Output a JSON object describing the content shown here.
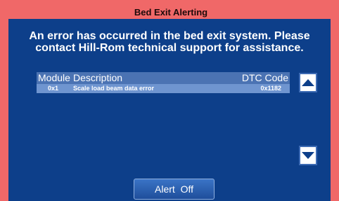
{
  "window": {
    "title": "Bed Exit Alerting"
  },
  "colors": {
    "frame": "#f06868",
    "panel": "#0d3f8a",
    "header_row": "#4b73b3",
    "data_row": "#6f95d0"
  },
  "message": {
    "line1": "An error has occurred in the bed exit system. Please",
    "line2": "contact Hill-Rom technical support for assistance."
  },
  "table": {
    "headers": {
      "module": "Module",
      "description": "Description",
      "dtc": "DTC Code"
    },
    "rows": [
      {
        "module": "0x1",
        "description": "Scale load beam data error",
        "dtc": "0x1182"
      }
    ]
  },
  "controls": {
    "scroll_up_icon": "triangle-up-icon",
    "scroll_down_icon": "triangle-down-icon",
    "alert_button": {
      "label": "Alert",
      "state": "Off"
    }
  }
}
